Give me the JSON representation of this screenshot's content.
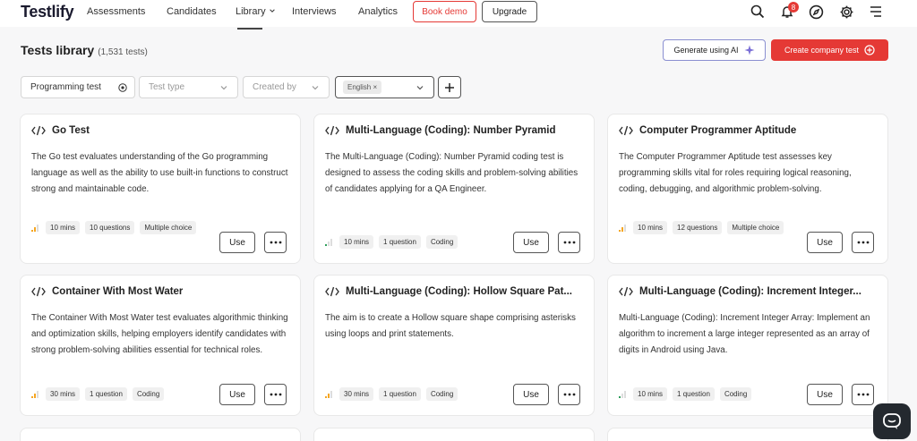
{
  "nav": {
    "logo": "Testlify",
    "links": [
      "Assessments",
      "Candidates",
      "Library",
      "Interviews",
      "Analytics"
    ],
    "book_demo": "Book demo",
    "upgrade": "Upgrade",
    "notification_count": "8"
  },
  "header": {
    "title": "Tests library",
    "count": "(1,531 tests)",
    "generate_ai": "Generate using AI",
    "create_test": "Create company test"
  },
  "filters": {
    "search_value": "Programming test",
    "test_type_placeholder": "Test type",
    "created_by_placeholder": "Created by",
    "language_chip": "English"
  },
  "cards": [
    {
      "title": "Go Test",
      "desc": "The Go test evaluates understanding of the Go programming language as well as the ability to use built-in functions to construct strong and maintainable code.",
      "time": "10 mins",
      "qcount": "10 questions",
      "type": "Multiple choice",
      "level": "medium",
      "use": "Use"
    },
    {
      "title": "Multi-Language (Coding): Number Pyramid",
      "desc": "The Multi-Language (Coding): Number Pyramid coding test is designed to assess the coding skills and problem-solving abilities of candidates applying for a QA Engineer.",
      "time": "10 mins",
      "qcount": "1 question",
      "type": "Coding",
      "level": "easy",
      "use": "Use"
    },
    {
      "title": "Computer Programmer Aptitude",
      "desc": "The Computer Programmer Aptitude test assesses key programming skills vital for roles requiring logical reasoning, coding, debugging, and algorithmic problem-solving.",
      "time": "10 mins",
      "qcount": "12 questions",
      "type": "Multiple choice",
      "level": "medium",
      "use": "Use"
    },
    {
      "title": "Container With Most Water",
      "desc": "The Container With Most Water test evaluates algorithmic thinking and optimization skills, helping employers identify candidates with strong problem-solving abilities essential for technical roles.",
      "time": "30 mins",
      "qcount": "1 question",
      "type": "Coding",
      "level": "medium",
      "use": "Use"
    },
    {
      "title": "Multi-Language (Coding): Hollow Square Pat...",
      "desc": "The aim is to create a Hollow square shape comprising asterisks using loops and print statements.",
      "time": "30 mins",
      "qcount": "1 question",
      "type": "Coding",
      "level": "medium",
      "use": "Use"
    },
    {
      "title": "Multi-Language (Coding): Increment Integer...",
      "desc": "Multi-Language (Coding): Increment Integer Array: Implement an algorithm to increment a large integer represented as an array of digits in Android using Java.",
      "time": "10 mins",
      "qcount": "1 question",
      "type": "Coding",
      "level": "easy",
      "use": "Use"
    }
  ],
  "colors": {
    "accent": "#e53935",
    "level_medium": "#f5a623",
    "level_easy": "#2e9e5b"
  }
}
